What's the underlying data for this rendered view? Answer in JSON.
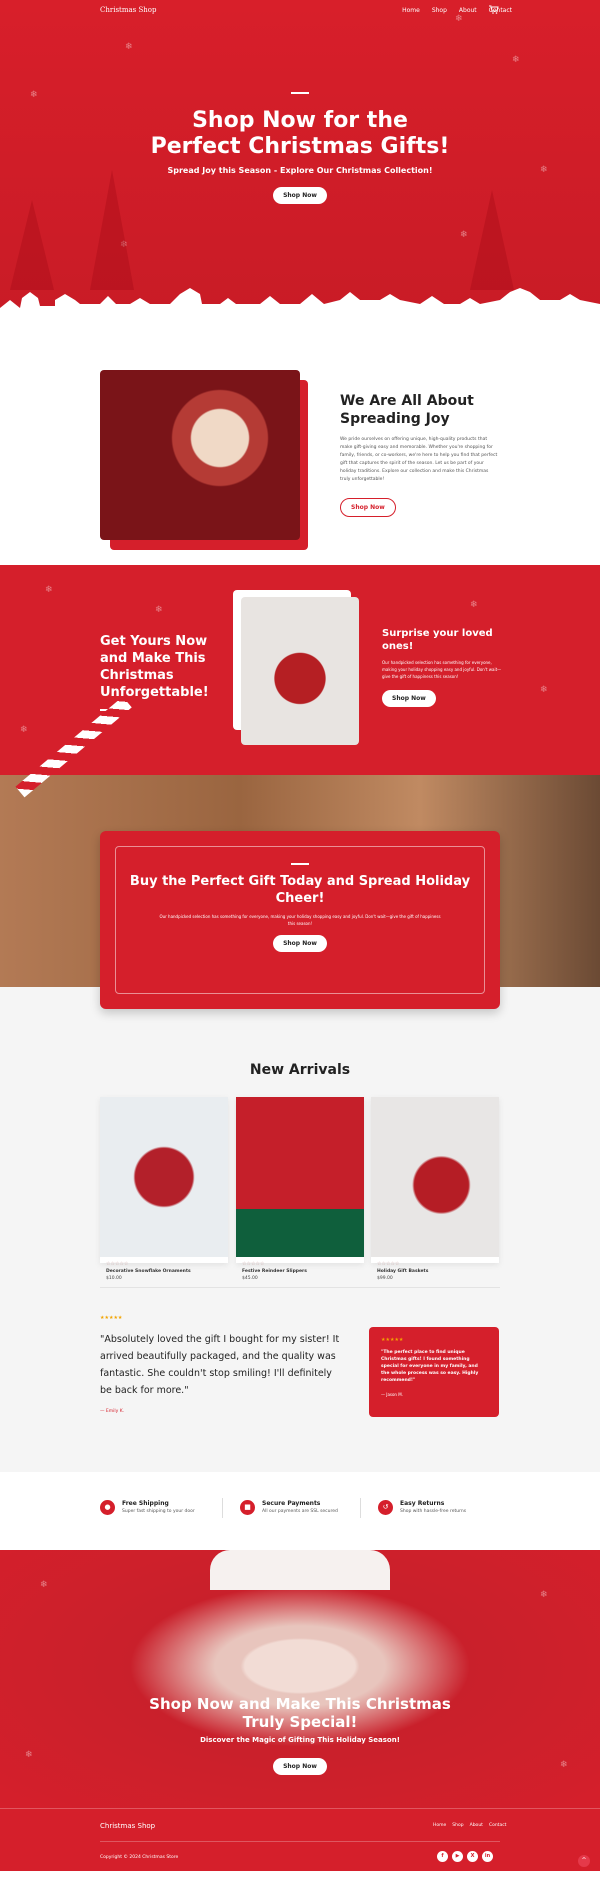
{
  "nav": {
    "brand": "Christmas Shop",
    "links": [
      "Home",
      "Shop",
      "About",
      "Contact"
    ]
  },
  "hero": {
    "title_line1": "Shop Now for the",
    "title_line2": "Perfect Christmas Gifts!",
    "subtitle": "Spread Joy this Season - Explore Our Christmas Collection!",
    "button": "Shop Now"
  },
  "about": {
    "title_line1": "We Are All About",
    "title_line2": "Spreading Joy",
    "text": "We pride ourselves on offering unique, high-quality products that make gift-giving easy and memorable. Whether you're shopping for family, friends, or co-workers, we're here to help you find that perfect gift that captures the spirit of the season. Let us be part of your holiday traditions. Explore our collection and make this Christmas truly unforgettable!",
    "button": "Shop Now"
  },
  "gift": {
    "title": "Get Yours Now and Make This Christmas Unforgettable!",
    "card_title": "Surprise your loved ones!",
    "card_text": "Our handpicked selection has something for everyone, making your holiday shopping easy and joyful. Don't wait—give the gift of happiness this season!",
    "button": "Shop Now"
  },
  "banner": {
    "title": "Buy the Perfect Gift Today and Spread Holiday Cheer!",
    "text": "Our handpicked selection has something for everyone, making your holiday shopping easy and joyful. Don't wait—give the gift of happiness this season!",
    "button": "Shop Now"
  },
  "arrivals": {
    "title": "New Arrivals",
    "products": [
      {
        "stars": "☆☆☆☆☆",
        "name": "Decorative Snowflake Ornaments",
        "price": "$10.00"
      },
      {
        "stars": "☆☆☆☆☆",
        "name": "Festive Reindeer Slippers",
        "price": "$45.00"
      },
      {
        "stars": "☆☆☆☆☆",
        "name": "Holiday Gift Baskets",
        "price": "$99.00"
      }
    ]
  },
  "testimonial": {
    "stars": "★★★★★",
    "quote": "\"Absolutely loved the gift I bought for my sister! It arrived beautifully packaged, and the quality was fantastic. She couldn't stop smiling! I'll definitely be back for more.\"",
    "author": "— Emily K.",
    "card_stars": "★★★★★",
    "card_quote": "\"The perfect place to find unique Christmas gifts! I found something special for everyone in my family, and the whole process was so easy. Highly recommend!\"",
    "card_author": "— Jason M."
  },
  "features": [
    {
      "icon": "●",
      "title": "Free Shipping",
      "text": "Super fast shipping to your door"
    },
    {
      "icon": "■",
      "title": "Secure Payments",
      "text": "All our payments are SSL secured"
    },
    {
      "icon": "↺",
      "title": "Easy Returns",
      "text": "Shop with hassle-free returns"
    }
  ],
  "santa": {
    "title_line1": "Shop Now and Make This Christmas",
    "title_line2": "Truly Special!",
    "subtitle": "Discover the Magic of Gifting This Holiday Season!",
    "button": "Shop Now"
  },
  "footer": {
    "brand": "Christmas Shop",
    "links": [
      "Home",
      "Shop",
      "About",
      "Contact"
    ],
    "copyright": "Copyright © 2024 Christmas Store",
    "socials": [
      "f",
      "▶",
      "X",
      "in"
    ],
    "to_top": "^"
  },
  "colors": {
    "primary": "#d51f2b",
    "white": "#ffffff"
  }
}
